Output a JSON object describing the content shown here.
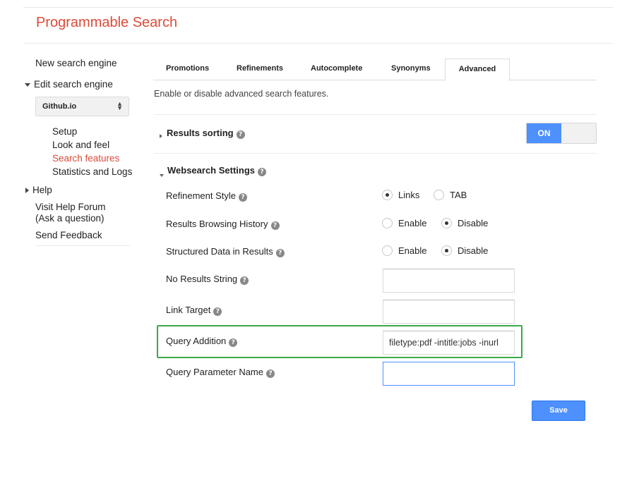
{
  "header": {
    "title": "Programmable Search"
  },
  "sidebar": {
    "new_engine": "New search engine",
    "edit_engine": "Edit search engine",
    "engine_select": "Github.io",
    "sub_items": [
      {
        "label": "Setup"
      },
      {
        "label": "Look and feel"
      },
      {
        "label": "Search features"
      },
      {
        "label": "Statistics and Logs"
      }
    ],
    "help": "Help",
    "forum_line1": "Visit Help Forum",
    "forum_line2": "(Ask a question)",
    "feedback": "Send Feedback"
  },
  "tabs": [
    {
      "label": "Promotions"
    },
    {
      "label": "Refinements"
    },
    {
      "label": "Autocomplete"
    },
    {
      "label": "Synonyms"
    },
    {
      "label": "Advanced"
    }
  ],
  "active_tab": "Advanced",
  "intro": "Enable or disable advanced search features.",
  "results_sorting": {
    "label": "Results sorting",
    "toggle": "ON"
  },
  "websearch": {
    "label": "Websearch Settings",
    "refinement_style": {
      "label": "Refinement Style",
      "opt1": "Links",
      "opt2": "TAB",
      "selected": "Links"
    },
    "browsing_history": {
      "label": "Results Browsing History",
      "opt1": "Enable",
      "opt2": "Disable",
      "selected": "Disable"
    },
    "structured_data": {
      "label": "Structured Data in Results",
      "opt1": "Enable",
      "opt2": "Disable",
      "selected": "Disable"
    },
    "no_results": {
      "label": "No Results String",
      "value": ""
    },
    "link_target": {
      "label": "Link Target",
      "value": ""
    },
    "query_addition": {
      "label": "Query Addition",
      "value": "filetype:pdf -intitle:jobs -inurl"
    },
    "query_param": {
      "label": "Query Parameter Name",
      "value": ""
    }
  },
  "save_label": "Save",
  "colors": {
    "brand": "#dd4b39",
    "accent": "#4d90fe",
    "highlight": "#3aaa4a"
  }
}
